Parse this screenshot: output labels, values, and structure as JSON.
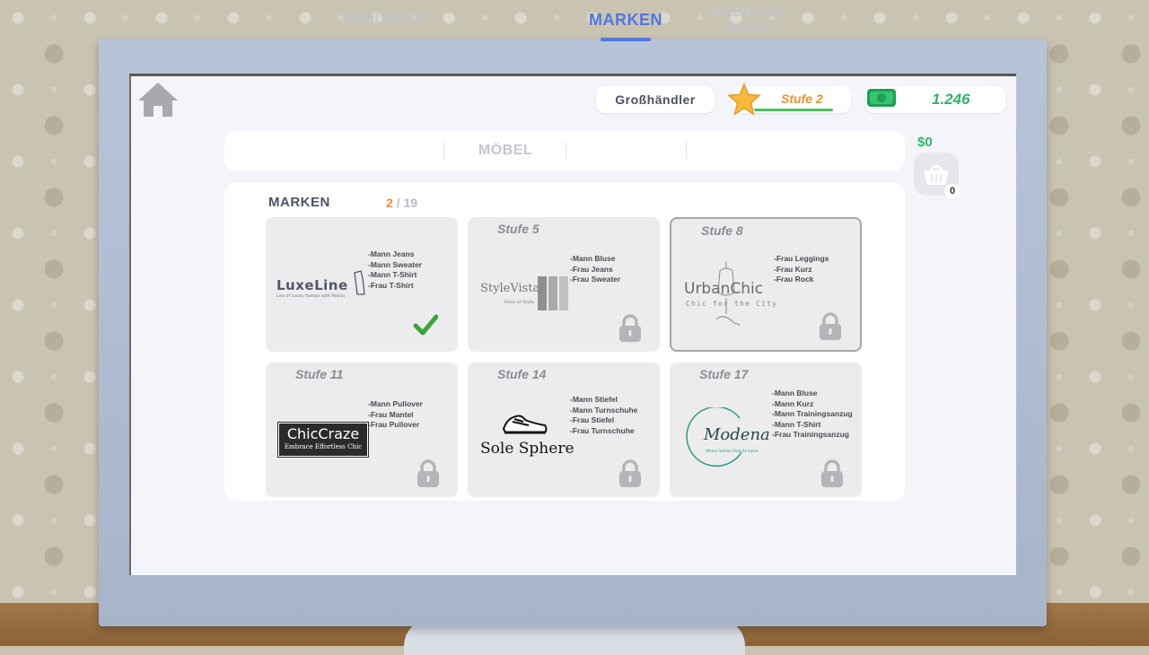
{
  "topbar": {
    "wholesale_label": "Großhändler",
    "level_label": "Stufe 2",
    "money_value": "1.246"
  },
  "tabs": [
    {
      "label": "PRODUKTE",
      "active": false
    },
    {
      "label": "MÖBEL",
      "active": false
    },
    {
      "label": "MARKEN",
      "active": true
    },
    {
      "label": "SPEZIELLES\nDESIGN",
      "active": false
    }
  ],
  "cart": {
    "price": "$0",
    "count": "0"
  },
  "panel": {
    "title": "MARKEN",
    "current": "2",
    "total_text": "/ 19"
  },
  "brands": [
    {
      "level": "",
      "items": [
        "-Mann Jeans",
        "-Mann Sweater",
        "-Mann T-Shirt",
        "-Frau T-Shirt"
      ],
      "logo_name": "LuxeLine",
      "logo_tagline": "Line of luxury fashion with flexion",
      "owned": true
    },
    {
      "level": "Stufe 5",
      "items": [
        "-Mann Bluse",
        "-Frau Jeans",
        "-Frau Sweater"
      ],
      "logo_name": "StyleVista",
      "logo_tagline": "Vista of Style",
      "owned": false
    },
    {
      "level": "Stufe 8",
      "items": [
        "-Frau Leggings",
        "-Frau Kurz",
        "-Frau Rock"
      ],
      "logo_name": "UrbanChic",
      "logo_tagline": "Chic for the City",
      "owned": false
    },
    {
      "level": "Stufe 11",
      "items": [
        "-Mann Pullover",
        "-Frau Mantel",
        "-Frau Pullover"
      ],
      "logo_name": "ChicCraze",
      "logo_tagline": "Embrace Effortless Chic",
      "owned": false
    },
    {
      "level": "Stufe 14",
      "items": [
        "-Mann Stiefel",
        "-Mann Turnschuhe",
        "-Frau Stiefel",
        "-Frau Turnschuhe"
      ],
      "logo_name": "Sole Sphere",
      "logo_tagline": "",
      "owned": false
    },
    {
      "level": "Stufe 17",
      "items": [
        "-Mann Bluse",
        "-Mann Kurz",
        "-Mann Trainingsanzug",
        "-Mann T-Shirt",
        "-Frau Trainingsanzug"
      ],
      "logo_name": "Modena",
      "logo_tagline": "Where fashion finds its home",
      "owned": false
    }
  ],
  "colors": {
    "accent_blue": "#4f77df",
    "level_orange": "#f0922d",
    "money_green": "#2fb56a",
    "check_green": "#3aa63a"
  }
}
